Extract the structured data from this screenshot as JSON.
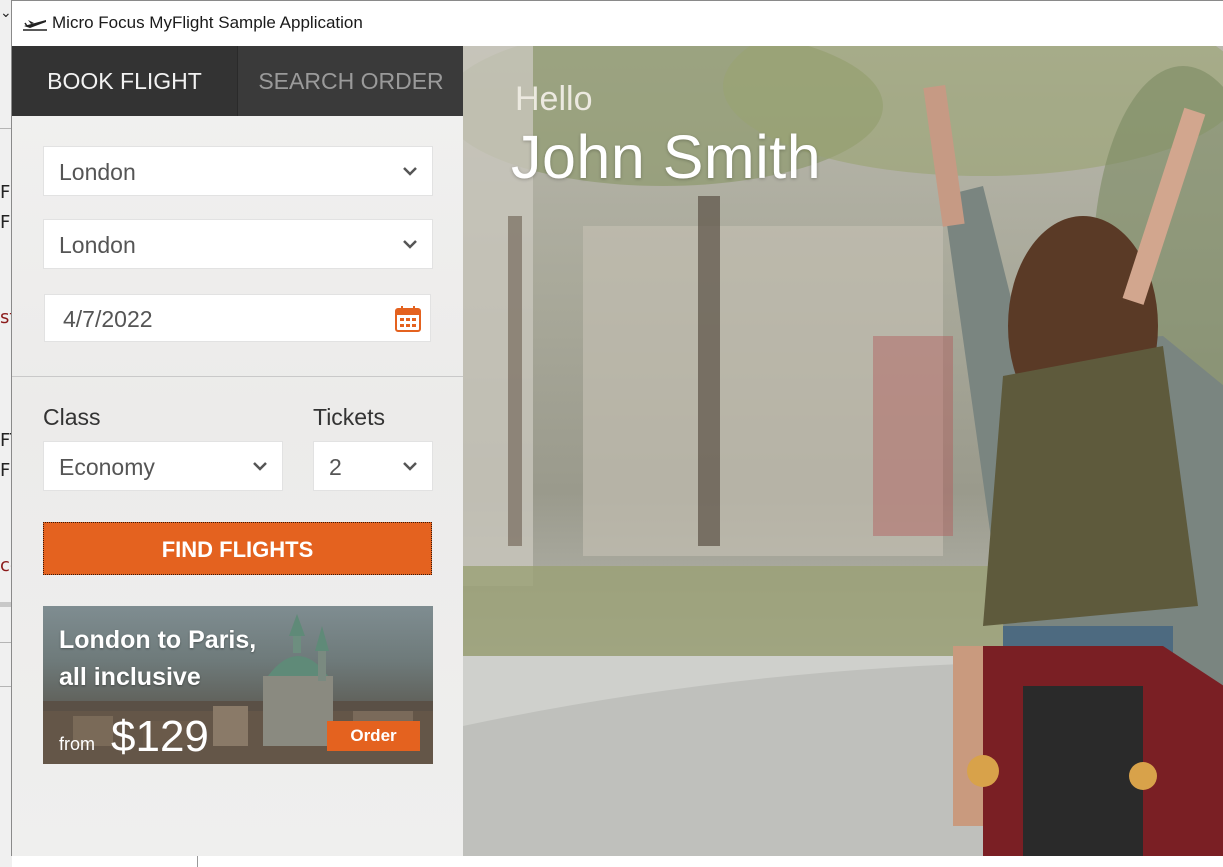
{
  "window": {
    "title": "Micro Focus MyFlight Sample Application",
    "icon": "airplane-icon"
  },
  "tabs": [
    {
      "label": "BOOK FLIGHT",
      "active": true
    },
    {
      "label": "SEARCH ORDER",
      "active": false
    }
  ],
  "booking": {
    "from_city": "London",
    "to_city": "London",
    "date": "4/7/2022",
    "class_label": "Class",
    "class_value": "Economy",
    "tickets_label": "Tickets",
    "tickets_value": "2",
    "find_button": "FIND FLIGHTS"
  },
  "promo": {
    "title_line1": "London to Paris,",
    "title_line2": "all inclusive",
    "from_label": "from",
    "price": "$129",
    "order_button": "Order"
  },
  "greeting": {
    "hello": "Hello",
    "user_name": "John Smith"
  },
  "colors": {
    "accent": "#e4621f",
    "tab_bar": "#333333",
    "panel_bg": "#efefee"
  }
}
